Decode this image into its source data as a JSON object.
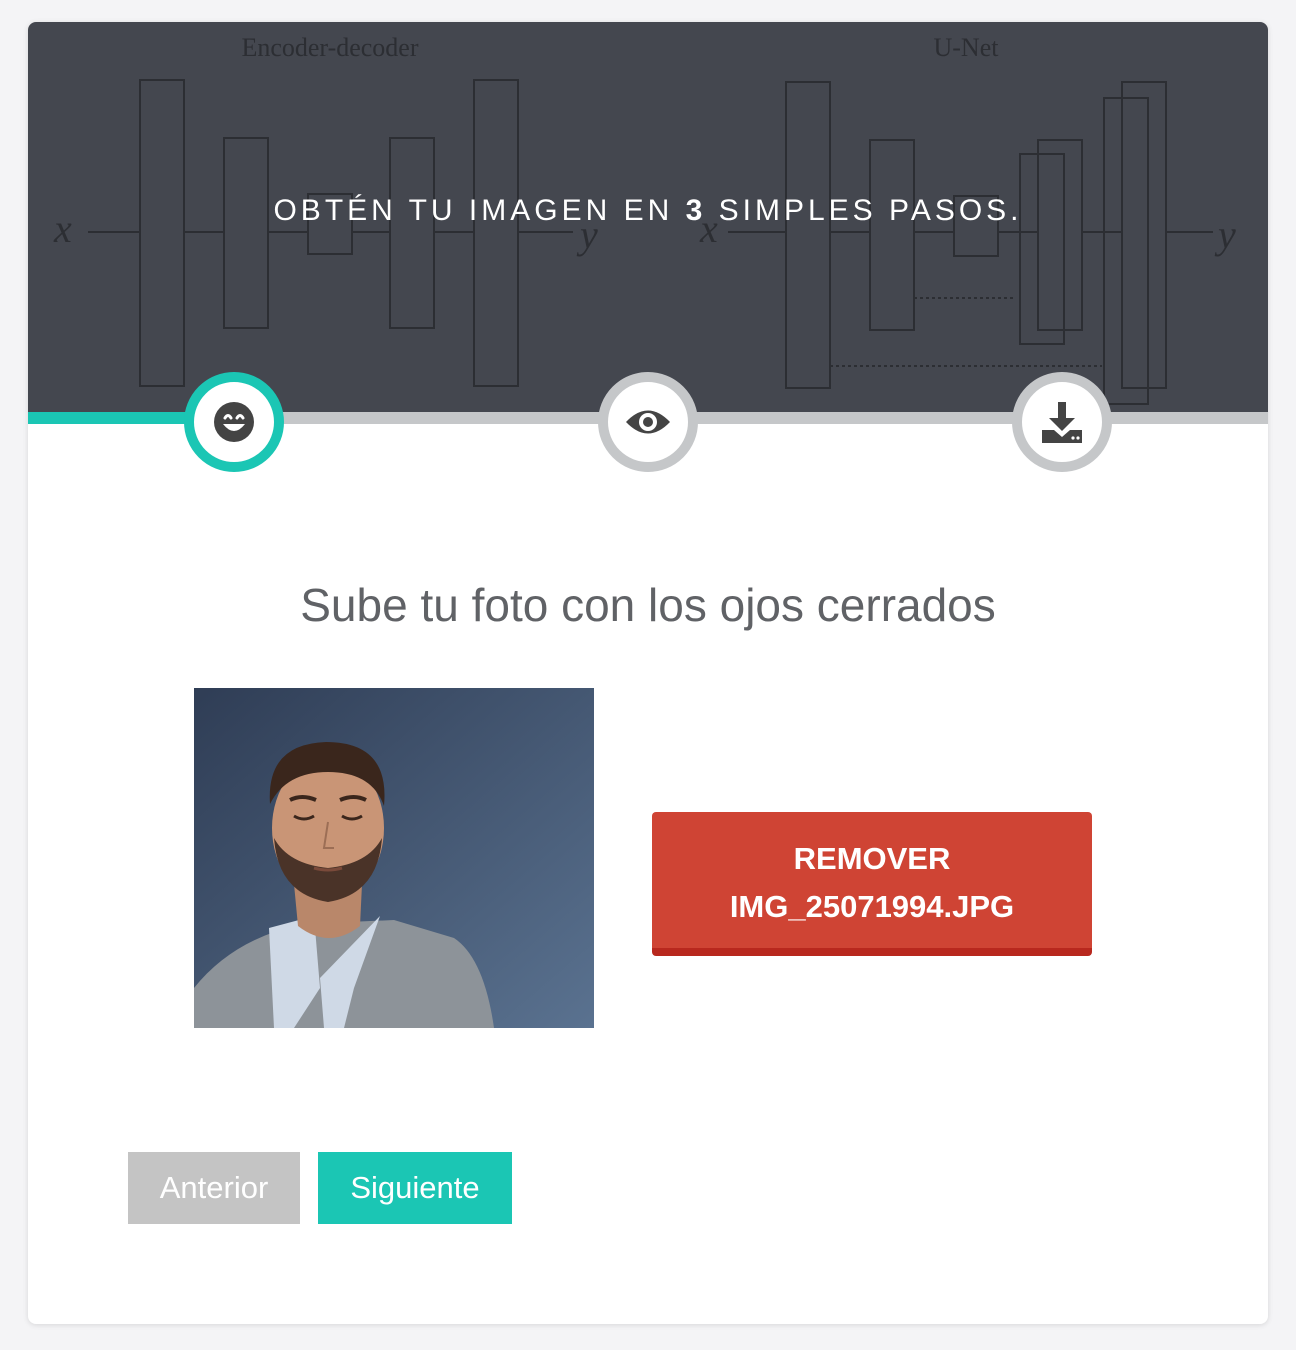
{
  "hero": {
    "title_pre": "OBTÉN TU IMAGEN EN ",
    "title_num": "3",
    "title_post": " SIMPLES PASOS.",
    "diagram": {
      "left_label": "Encoder-decoder",
      "right_label": "U-Net",
      "x_symbol": "x",
      "y_symbol": "y"
    }
  },
  "steps": [
    {
      "icon": "smile-icon",
      "state": "active"
    },
    {
      "icon": "eye-icon",
      "state": "inactive"
    },
    {
      "icon": "download-icon",
      "state": "inactive"
    }
  ],
  "progress": {
    "current_step": 1,
    "total_steps": 3
  },
  "main": {
    "heading": "Sube tu foto con los ojos cerrados",
    "remove_line1": "REMOVER",
    "remove_line2": "IMG_25071994.JPG"
  },
  "nav": {
    "prev_label": "Anterior",
    "next_label": "Siguiente"
  },
  "colors": {
    "accent": "#1bc6b4",
    "danger": "#cf4434",
    "hero_bg": "#44474f",
    "inactive": "#c5c7c9"
  }
}
